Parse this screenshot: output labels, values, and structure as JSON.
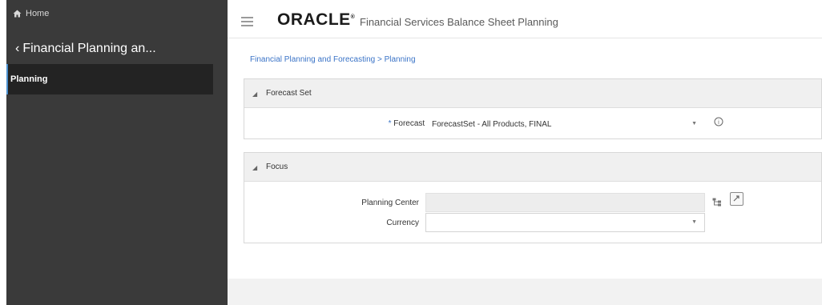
{
  "sidebar": {
    "home_label": "Home",
    "back_label": "Financial Planning an...",
    "items": [
      {
        "label": "Planning",
        "active": true
      }
    ]
  },
  "header": {
    "logo_text": "ORACLE",
    "logo_mark": "®",
    "app_title": "Financial Services Balance Sheet Planning"
  },
  "breadcrumb": "Financial Planning and Forecasting > Planning",
  "forecast_set_section": {
    "title": "Forecast Set",
    "field_label": "Forecast Set",
    "required_marker": "*",
    "value": "ForecastSet - All Products, FINAL"
  },
  "focus_section": {
    "title": "Focus",
    "planning_center_label": "Planning Center",
    "planning_center_value": "",
    "currency_label": "Currency",
    "currency_value": ""
  },
  "colors": {
    "sidebar_bg": "#3a3a3a",
    "sidebar_active_bg": "#232323",
    "accent": "#3b74c7"
  },
  "icons": [
    "home-icon",
    "back-chevron-icon",
    "hamburger-icon",
    "collapse-triangle-icon",
    "dropdown-caret-icon",
    "info-icon",
    "hierarchy-browser-icon",
    "refresh-icon"
  ]
}
